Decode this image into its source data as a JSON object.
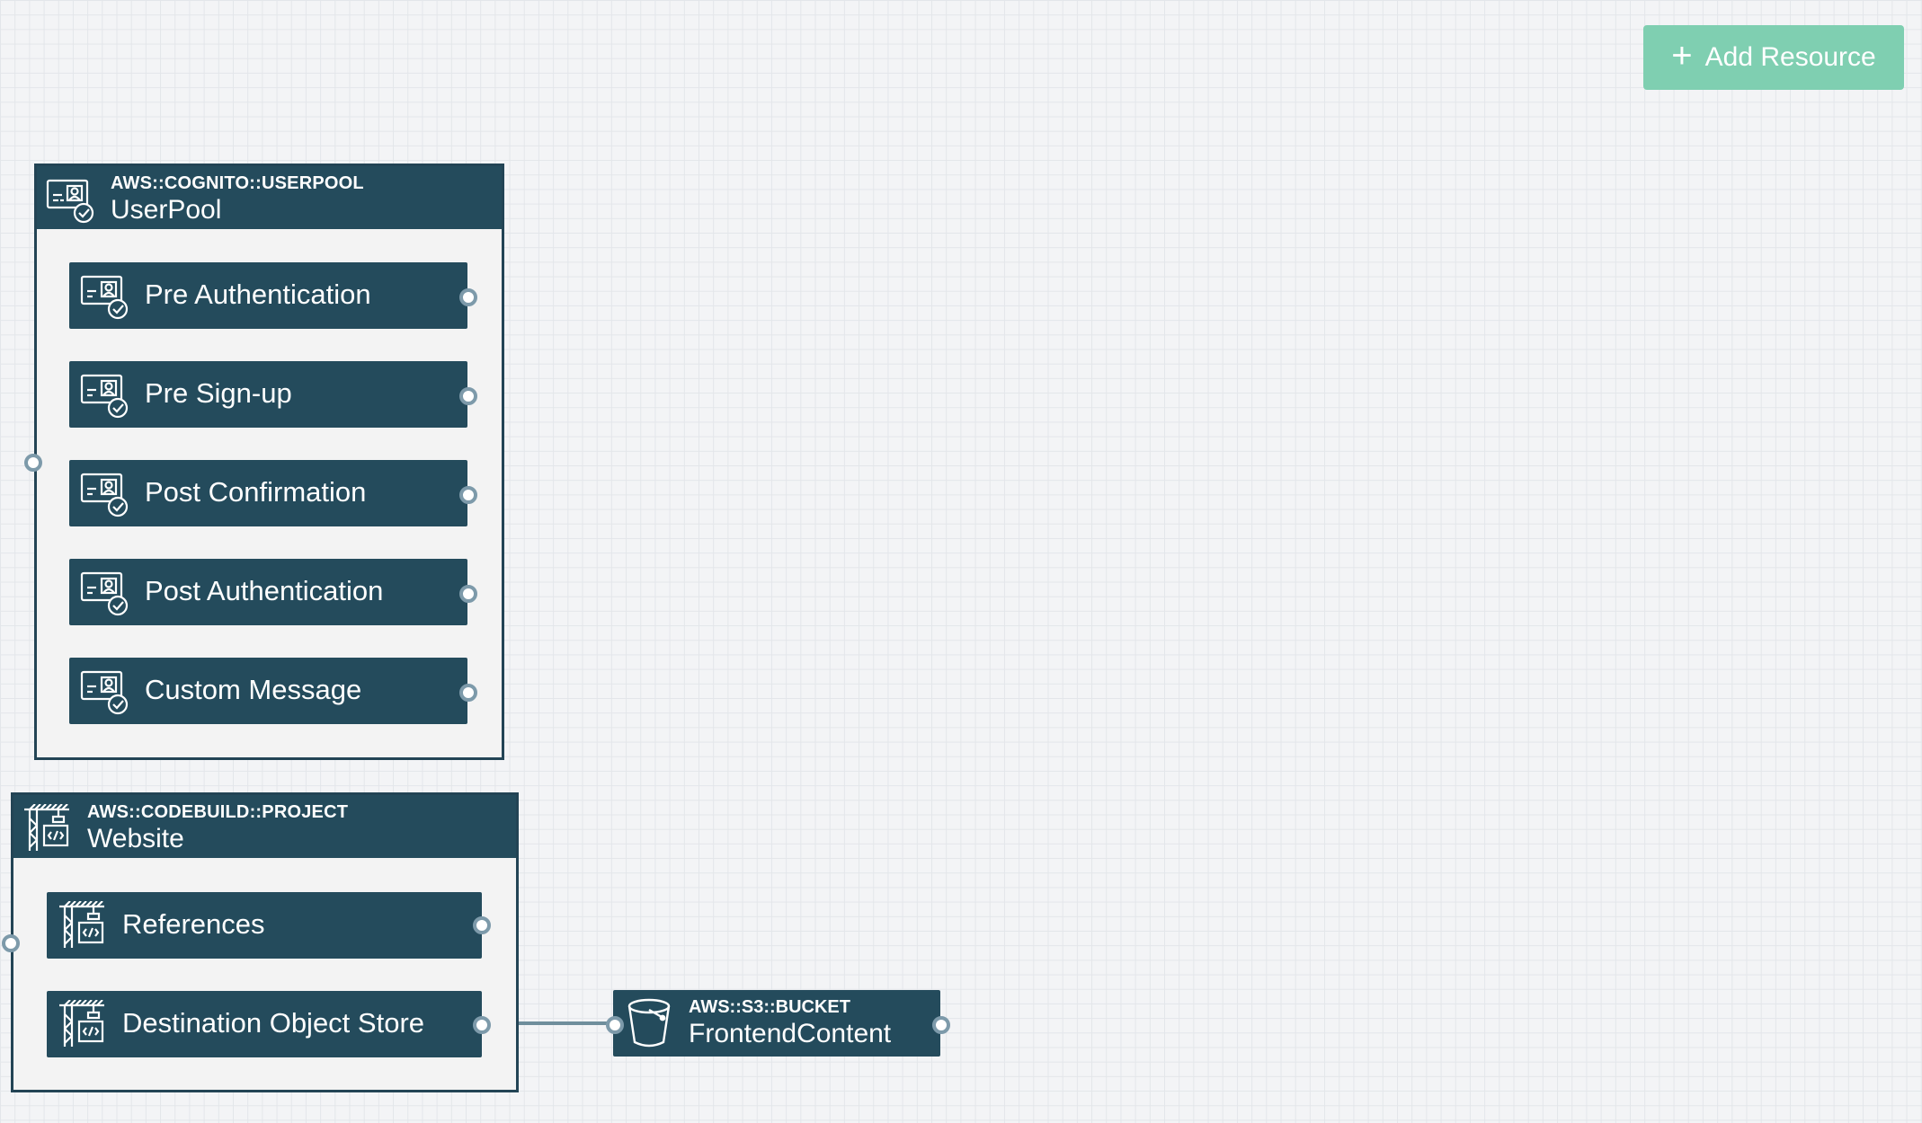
{
  "toolbar": {
    "add_resource_label": "Add Resource",
    "add_icon": "plus-icon"
  },
  "userpool": {
    "type": "AWS::COGNITO::USERPOOL",
    "name": "UserPool",
    "icon": "cognito-userpool-icon",
    "items": [
      {
        "label": "Pre Authentication",
        "icon": "cognito-userpool-icon"
      },
      {
        "label": "Pre Sign-up",
        "icon": "cognito-userpool-icon"
      },
      {
        "label": "Post Confirmation",
        "icon": "cognito-userpool-icon"
      },
      {
        "label": "Post Authentication",
        "icon": "cognito-userpool-icon"
      },
      {
        "label": "Custom Message",
        "icon": "cognito-userpool-icon"
      }
    ]
  },
  "website": {
    "type": "AWS::CODEBUILD::PROJECT",
    "name": "Website",
    "icon": "codebuild-icon",
    "items": [
      {
        "label": "References",
        "icon": "codebuild-icon"
      },
      {
        "label": "Destination Object Store",
        "icon": "codebuild-icon"
      }
    ]
  },
  "bucket": {
    "type": "AWS::S3::BUCKET",
    "name": "FrontendContent",
    "icon": "s3-bucket-icon"
  },
  "colors": {
    "node": "#244b5c",
    "node_border": "#234455",
    "accent": "#7fcfb1",
    "port": "#7d9aaa",
    "canvas": "#f3f4f6"
  }
}
